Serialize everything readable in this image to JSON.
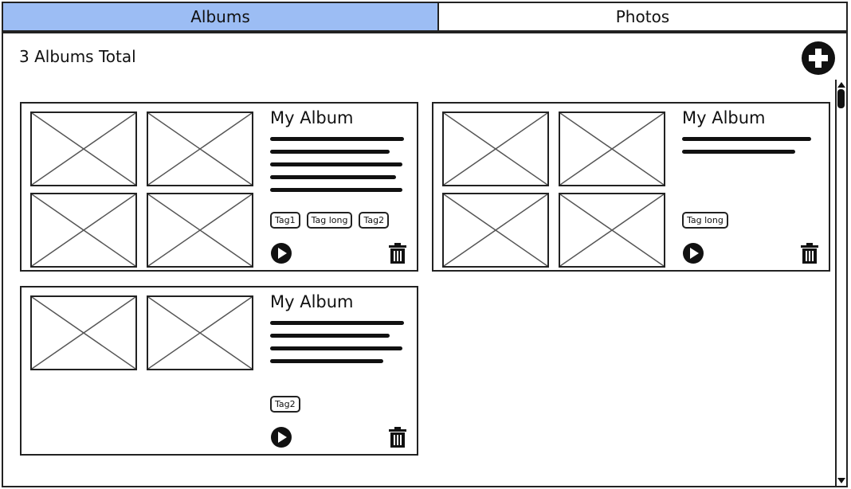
{
  "tabs": [
    {
      "label": "Albums",
      "active": true
    },
    {
      "label": "Photos",
      "active": false
    }
  ],
  "header": {
    "count_label": "3 Albums Total",
    "add_icon": "plus-circle-icon"
  },
  "albums": [
    {
      "title": "My Album",
      "tags": [
        "Tag1",
        "Tag long",
        "Tag2"
      ],
      "photo_count": 4,
      "text_lines": 5
    },
    {
      "title": "My Album",
      "tags": [
        "Tag long"
      ],
      "photo_count": 4,
      "text_lines": 2
    },
    {
      "title": "My Album",
      "tags": [
        "Tag2"
      ],
      "photo_count": 2,
      "text_lines": 4
    }
  ],
  "icons": {
    "play": "play-circle-icon",
    "delete": "trash-icon",
    "placeholder": "image-placeholder-icon"
  },
  "colors": {
    "active_tab": "#9cbdf4",
    "border": "#222222"
  }
}
